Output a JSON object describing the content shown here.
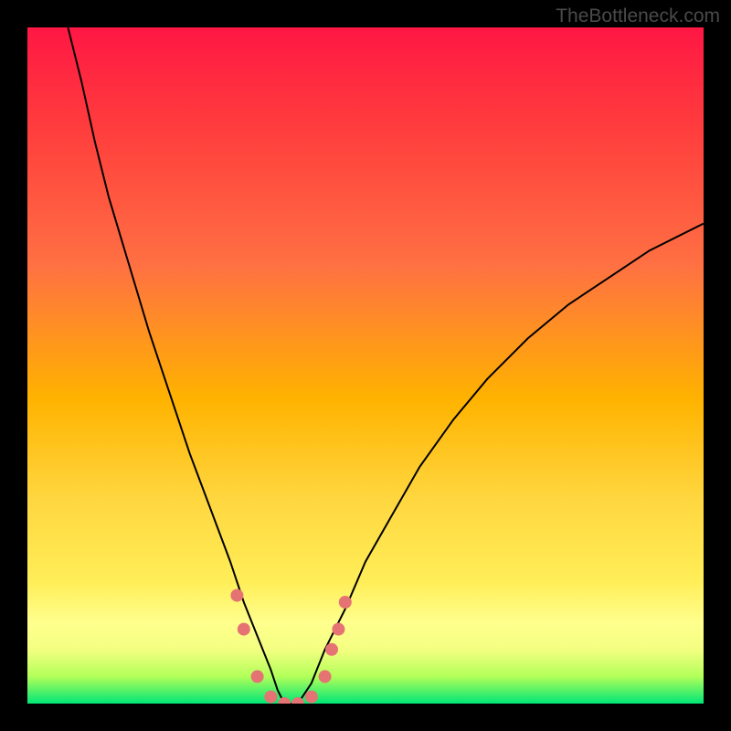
{
  "watermark": "TheBottleneck.com",
  "chart_data": {
    "type": "line",
    "title": "",
    "xlabel": "",
    "ylabel": "",
    "xlim": [
      0,
      100
    ],
    "ylim": [
      0,
      100
    ],
    "background_gradient": {
      "type": "vertical",
      "stops": [
        {
          "pos": 0.0,
          "color": "#ff1744"
        },
        {
          "pos": 0.15,
          "color": "#ff3d3d"
        },
        {
          "pos": 0.35,
          "color": "#ff7043"
        },
        {
          "pos": 0.55,
          "color": "#ffb300"
        },
        {
          "pos": 0.7,
          "color": "#ffd740"
        },
        {
          "pos": 0.82,
          "color": "#ffee58"
        },
        {
          "pos": 0.88,
          "color": "#ffff8d"
        },
        {
          "pos": 0.92,
          "color": "#f4ff81"
        },
        {
          "pos": 0.96,
          "color": "#b2ff59"
        },
        {
          "pos": 1.0,
          "color": "#00e676"
        }
      ]
    },
    "series": [
      {
        "name": "bottleneck-curve",
        "color": "#000000",
        "stroke_width": 2,
        "x": [
          6,
          8,
          10,
          12,
          15,
          18,
          21,
          24,
          27,
          30,
          32,
          34,
          36,
          37,
          38,
          40,
          42,
          44,
          47,
          50,
          54,
          58,
          63,
          68,
          74,
          80,
          86,
          92,
          100
        ],
        "y": [
          100,
          92,
          83,
          75,
          65,
          55,
          46,
          37,
          29,
          21,
          15,
          10,
          5,
          2,
          0,
          0,
          3,
          8,
          14,
          21,
          28,
          35,
          42,
          48,
          54,
          59,
          63,
          67,
          71
        ]
      }
    ],
    "markers": {
      "name": "highlight-dots",
      "color": "#e57373",
      "radius": 7,
      "points": [
        {
          "x": 31,
          "y": 16
        },
        {
          "x": 32,
          "y": 11
        },
        {
          "x": 34,
          "y": 4
        },
        {
          "x": 36,
          "y": 1
        },
        {
          "x": 38,
          "y": 0
        },
        {
          "x": 40,
          "y": 0
        },
        {
          "x": 42,
          "y": 1
        },
        {
          "x": 44,
          "y": 4
        },
        {
          "x": 45,
          "y": 8
        },
        {
          "x": 46,
          "y": 11
        },
        {
          "x": 47,
          "y": 15
        }
      ]
    }
  }
}
